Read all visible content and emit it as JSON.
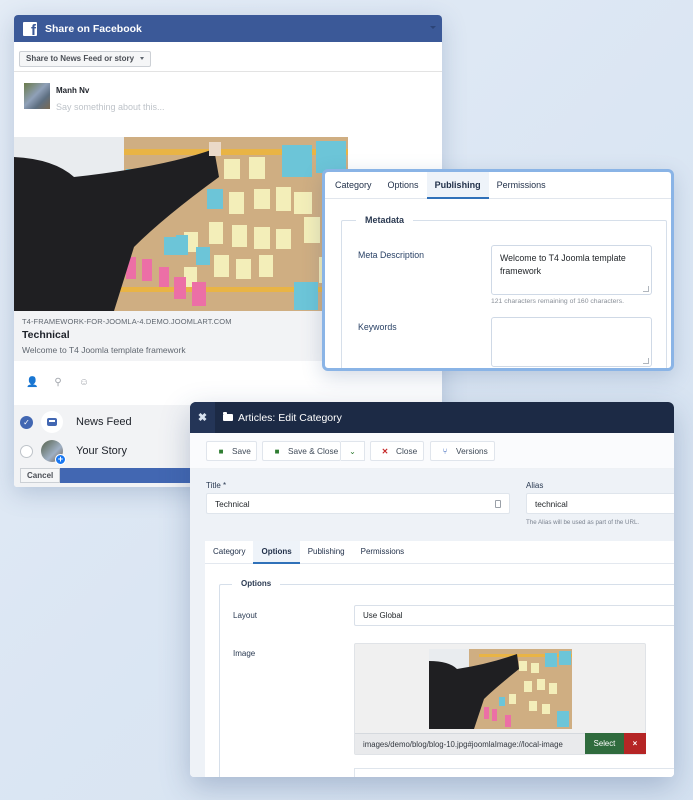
{
  "facebook": {
    "header_title": "Share on Facebook",
    "logo_glyph": "f",
    "share_select_value": "Share to News Feed or story",
    "user_name": "Manh Nv",
    "say_placeholder": "Say something about this...",
    "link": {
      "domain": "T4-FRAMEWORK-FOR-JOOMLA-4.DEMO.JOOMLART.COM",
      "title": "Technical",
      "description": "Welcome to T4 Joomla template framework"
    },
    "action_icons": [
      "tag-friends-icon",
      "location-pin-icon",
      "feeling-icon"
    ],
    "destinations": [
      {
        "label": "News Feed",
        "checked": true
      },
      {
        "label": "Your Story",
        "checked": false
      }
    ],
    "cancel_label": "Cancel",
    "brand_color": "#3b5998"
  },
  "publishing_panel": {
    "tabs": [
      {
        "label": "Category",
        "active": false
      },
      {
        "label": "Options",
        "active": false
      },
      {
        "label": "Publishing",
        "active": true
      },
      {
        "label": "Permissions",
        "active": false
      }
    ],
    "legend": "Metadata",
    "meta_description_label": "Meta Description",
    "meta_description_value": "Welcome to T4 Joomla template framework",
    "meta_description_hint": "121 characters remaining of 160 characters.",
    "keywords_label": "Keywords",
    "keywords_value": ""
  },
  "joomla": {
    "header_title": "Articles: Edit Category",
    "toolbar": {
      "save": "Save",
      "save_close": "Save & Close",
      "close": "Close",
      "versions": "Versions"
    },
    "title_label": "Title *",
    "title_value": "Technical",
    "alias_label": "Alias",
    "alias_value": "technical",
    "alias_hint": "The Alias will be used as part of the URL.",
    "tabs": [
      {
        "label": "Category",
        "active": false
      },
      {
        "label": "Options",
        "active": true
      },
      {
        "label": "Publishing",
        "active": false
      },
      {
        "label": "Permissions",
        "active": false
      }
    ],
    "options_legend": "Options",
    "layout_label": "Layout",
    "layout_value": "Use Global",
    "image_label": "Image",
    "image_path": "images/demo/blog/blog-10.jpg#joomlaImage://local-image",
    "select_label": "Select",
    "clear_glyph": "×",
    "header_color": "#1c2a45",
    "select_color": "#2f6b3d",
    "clear_color": "#b52525"
  }
}
